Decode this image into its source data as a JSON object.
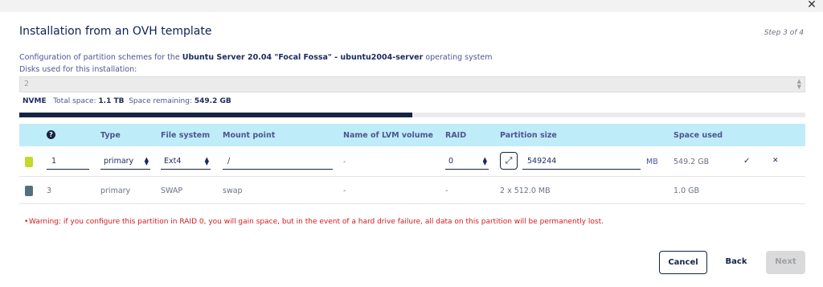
{
  "dialog": {
    "close_icon": "close-icon",
    "title": "Installation from an OVH template",
    "step": "Step 3 of 4"
  },
  "config": {
    "prefix": "Configuration of partition schemes for the ",
    "os_name": "Ubuntu Server 20.04 \"Focal Fossa\" - ubuntu2004-server",
    "suffix": " operating system",
    "disks_label": "Disks used for this installation:",
    "disks_value": "2"
  },
  "storage": {
    "type": "NVME",
    "total_label": "Total space:",
    "total_value": "1.1 TB",
    "remaining_label": "Space remaining:",
    "remaining_value": "549.2 GB",
    "used_fraction": 0.5
  },
  "table": {
    "headers": {
      "help": "?",
      "type": "Type",
      "filesystem": "File system",
      "mount": "Mount point",
      "lvm": "Name of LVM volume",
      "raid": "RAID",
      "size": "Partition size",
      "space_used": "Space used"
    },
    "rows": [
      {
        "color": "#c5d82b",
        "order": "1",
        "type": "primary",
        "filesystem": "Ext4",
        "mount": "/",
        "lvm": "-",
        "raid": "0",
        "size": "549244",
        "size_unit": "MB",
        "space_used": "549.2 GB",
        "confirm_icon": "✓",
        "cancel_icon": "✕"
      },
      {
        "color": "#53707f",
        "order": "3",
        "type": "primary",
        "filesystem": "SWAP",
        "mount": "swap",
        "lvm": "-",
        "raid": "-",
        "size": "2 x 512.0 MB",
        "space_used": "1.0 GB"
      }
    ]
  },
  "warning": {
    "bullet": "•",
    "text": "Warning: if you configure this partition in RAID 0, you will gain space, but in the event of a hard drive failure, all data on this partition will be permanently lost."
  },
  "buttons": {
    "cancel": "Cancel",
    "back": "Back",
    "next": "Next"
  }
}
